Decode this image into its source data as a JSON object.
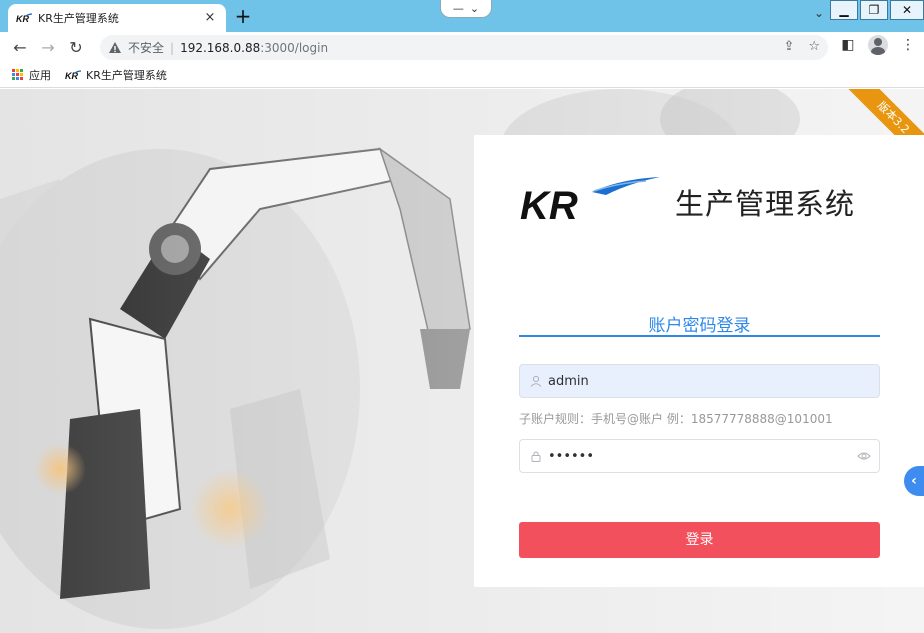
{
  "browser": {
    "tab_title": "KR生产管理系统",
    "tab_close": "×",
    "new_tab": "+",
    "insecure_label": "不安全",
    "url_host": "192.168.0.88",
    "url_path": ":3000/login",
    "bookmarks": [
      {
        "label": "应用"
      },
      {
        "label": "KR生产管理系统"
      }
    ]
  },
  "page": {
    "version_badge": "版本3.2",
    "logo_text": "KR",
    "system_title": "生产管理系统",
    "login_tab": "账户密码登录",
    "username_value": "admin",
    "hint": "子账户规则：手机号@账户 例：18577778888@101001",
    "password_value": "••••••",
    "login_button": "登录",
    "side_tab": "‹"
  },
  "colors": {
    "primary_blue": "#2f88e8",
    "login_red": "#f2505d",
    "ribbon_orange": "#e8960f",
    "tabbar": "#6fc3e8"
  }
}
